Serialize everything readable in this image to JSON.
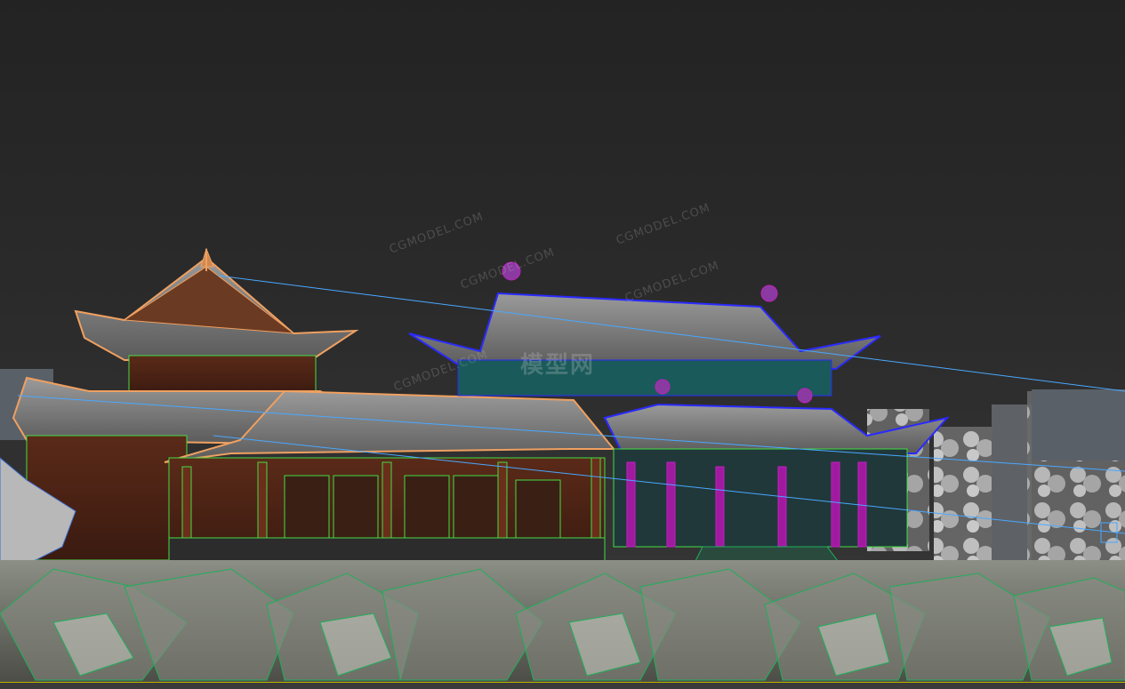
{
  "viewport": {
    "watermarks": [
      "CGMODEL.COM",
      "CGMODEL.COM",
      "CGMODEL.COM",
      "CGMODEL.COM",
      "CGMODEL.COM"
    ],
    "watermark_center": "模型网"
  },
  "colors": {
    "background": "#2b2b2b",
    "selected_wire": "#f0a060",
    "wire_green": "#44dd44",
    "wire_blue": "#2a2aff",
    "wire_magenta": "#c020c0",
    "guide_line": "#4aa8ff",
    "rock_wire": "#1fae5a"
  },
  "icons": [
    "pagoda-model",
    "gate-tower-model",
    "rock-ground",
    "tree-billboards"
  ]
}
